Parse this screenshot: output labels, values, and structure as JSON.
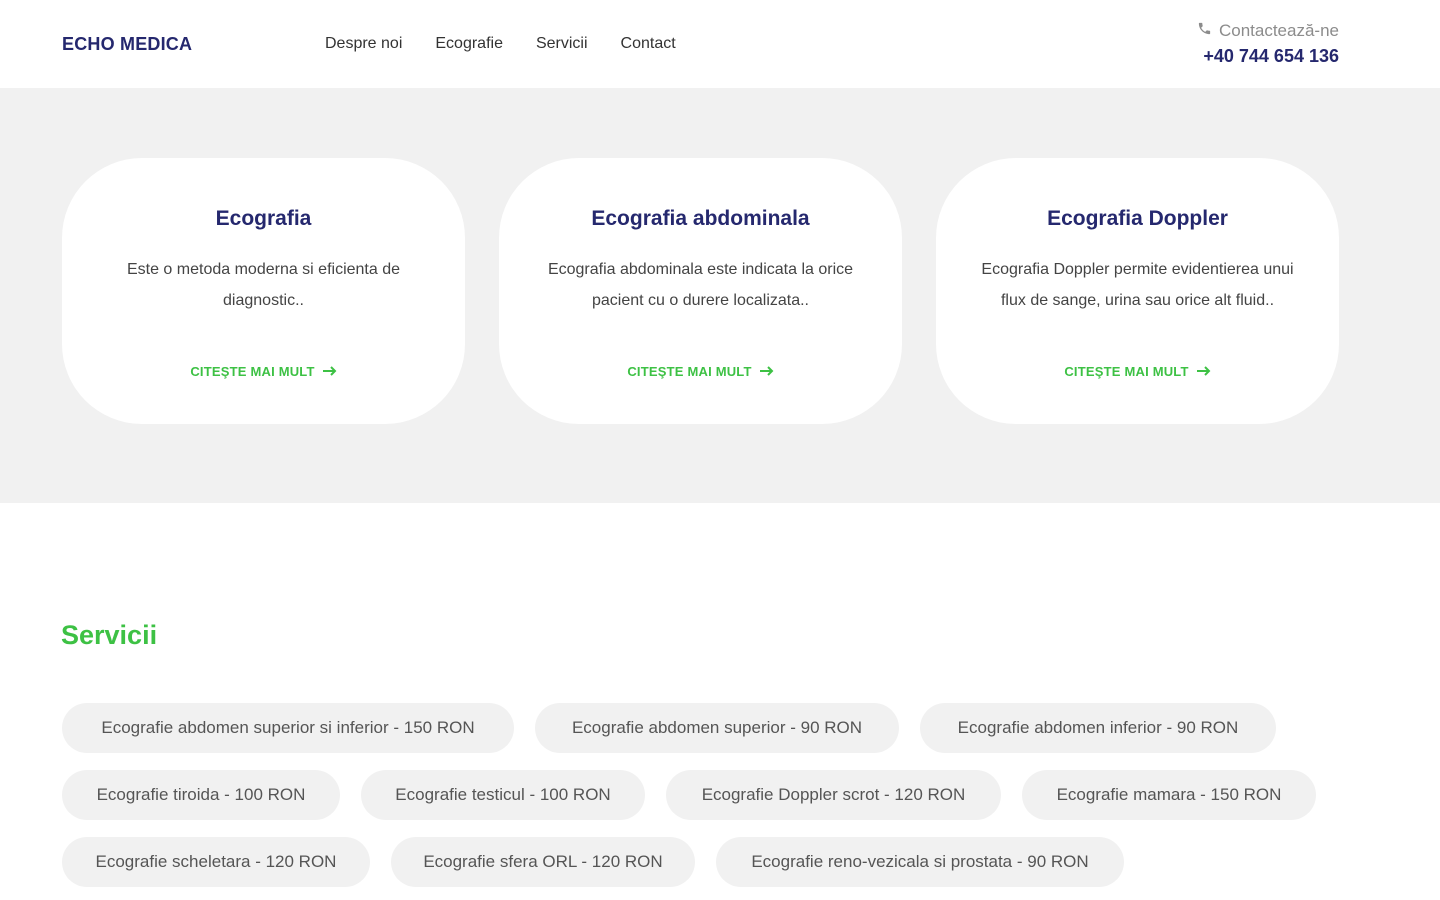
{
  "header": {
    "logo": "ECHO MEDICA",
    "nav": [
      "Despre noi",
      "Ecografie",
      "Servicii",
      "Contact"
    ],
    "contact_label": "Contactează-ne",
    "contact_phone": "+40 744 654 136"
  },
  "cards": [
    {
      "title": "Ecografia",
      "text": "Este o metoda moderna si eficienta de diagnostic..",
      "link": "CITEŞTE MAI MULT"
    },
    {
      "title": "Ecografia abdominala",
      "text": "Ecografia abdominala este indicata la orice pacient cu o durere localizata..",
      "link": "CITEŞTE MAI MULT"
    },
    {
      "title": "Ecografia Doppler",
      "text": "Ecografia Doppler permite evidentierea unui flux de sange, urina sau orice alt fluid..",
      "link": "CITEŞTE MAI MULT"
    }
  ],
  "services": {
    "title": "Servicii",
    "items": [
      "Ecografie abdomen superior si inferior - 150 RON",
      "Ecografie abdomen superior - 90 RON",
      "Ecografie abdomen inferior - 90 RON",
      "Ecografie tiroida - 100 RON",
      "Ecografie testicul - 100 RON",
      "Ecografie Doppler scrot - 120 RON",
      "Ecografie mamara - 150 RON",
      "Ecografie scheletara - 120 RON",
      "Ecografie sfera ORL - 120 RON",
      "Ecografie reno-vezicala si prostata - 90 RON"
    ]
  },
  "colors": {
    "brand_navy": "#25286e",
    "accent_green": "#3dc144",
    "section_gray": "#f1f1f1"
  },
  "icons": {
    "contact": "phone-icon",
    "card_link": "arrow-right-icon"
  }
}
